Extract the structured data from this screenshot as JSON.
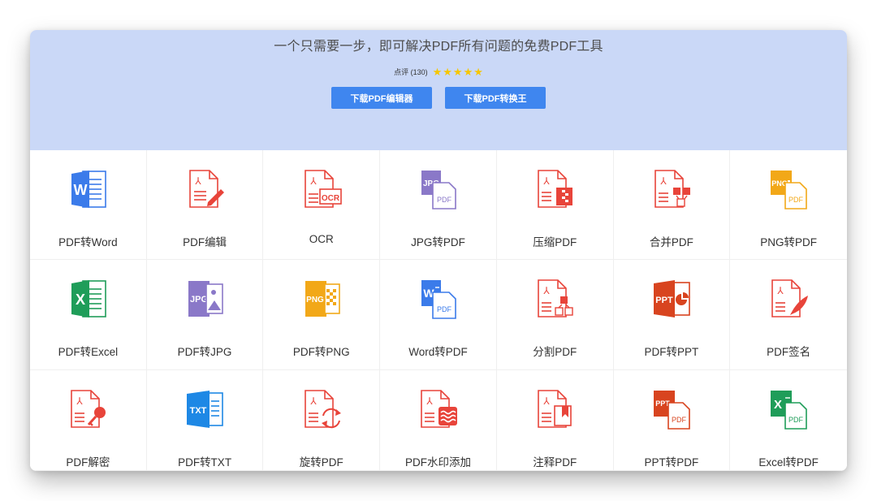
{
  "banner": {
    "headline": "一个只需要一步，即可解决PDF所有问题的免费PDF工具",
    "rating_text": "点评 (130)",
    "stars": 5,
    "buttons": [
      {
        "label": "下载PDF编辑器"
      },
      {
        "label": "下载PDF转换王"
      }
    ]
  },
  "colors": {
    "banner_bg": "#cad8f7",
    "button_bg": "#3f86ef",
    "pdf_red": "#e8443a",
    "word_blue": "#3b7bea",
    "excel_green": "#1f9d59",
    "jpg_purple": "#8a78c8",
    "png_orange": "#f2a818",
    "txt_blue": "#1e88e5",
    "ppt_red": "#d8441f"
  },
  "tools": [
    {
      "label": "PDF转Word",
      "icon": "word-file-icon"
    },
    {
      "label": "PDF编辑",
      "icon": "pdf-edit-pencil-icon"
    },
    {
      "label": "OCR",
      "icon": "pdf-ocr-icon"
    },
    {
      "label": "JPG转PDF",
      "icon": "jpg-to-pdf-icon"
    },
    {
      "label": "压缩PDF",
      "icon": "pdf-compress-icon"
    },
    {
      "label": "合并PDF",
      "icon": "pdf-merge-icon"
    },
    {
      "label": "PNG转PDF",
      "icon": "png-to-pdf-icon"
    },
    {
      "label": "PDF转Excel",
      "icon": "excel-file-icon"
    },
    {
      "label": "PDF转JPG",
      "icon": "jpg-image-icon"
    },
    {
      "label": "PDF转PNG",
      "icon": "png-image-icon"
    },
    {
      "label": "Word转PDF",
      "icon": "word-to-pdf-icon"
    },
    {
      "label": "分割PDF",
      "icon": "pdf-split-icon"
    },
    {
      "label": "PDF转PPT",
      "icon": "ppt-file-icon"
    },
    {
      "label": "PDF签名",
      "icon": "pdf-signature-icon"
    },
    {
      "label": "PDF解密",
      "icon": "pdf-decrypt-key-icon"
    },
    {
      "label": "PDF转TXT",
      "icon": "txt-file-icon"
    },
    {
      "label": "旋转PDF",
      "icon": "pdf-rotate-icon"
    },
    {
      "label": "PDF水印添加",
      "icon": "pdf-watermark-icon"
    },
    {
      "label": "注释PDF",
      "icon": "pdf-annotate-bookmark-icon"
    },
    {
      "label": "PPT转PDF",
      "icon": "ppt-to-pdf-icon"
    },
    {
      "label": "Excel转PDF",
      "icon": "excel-to-pdf-icon"
    }
  ]
}
